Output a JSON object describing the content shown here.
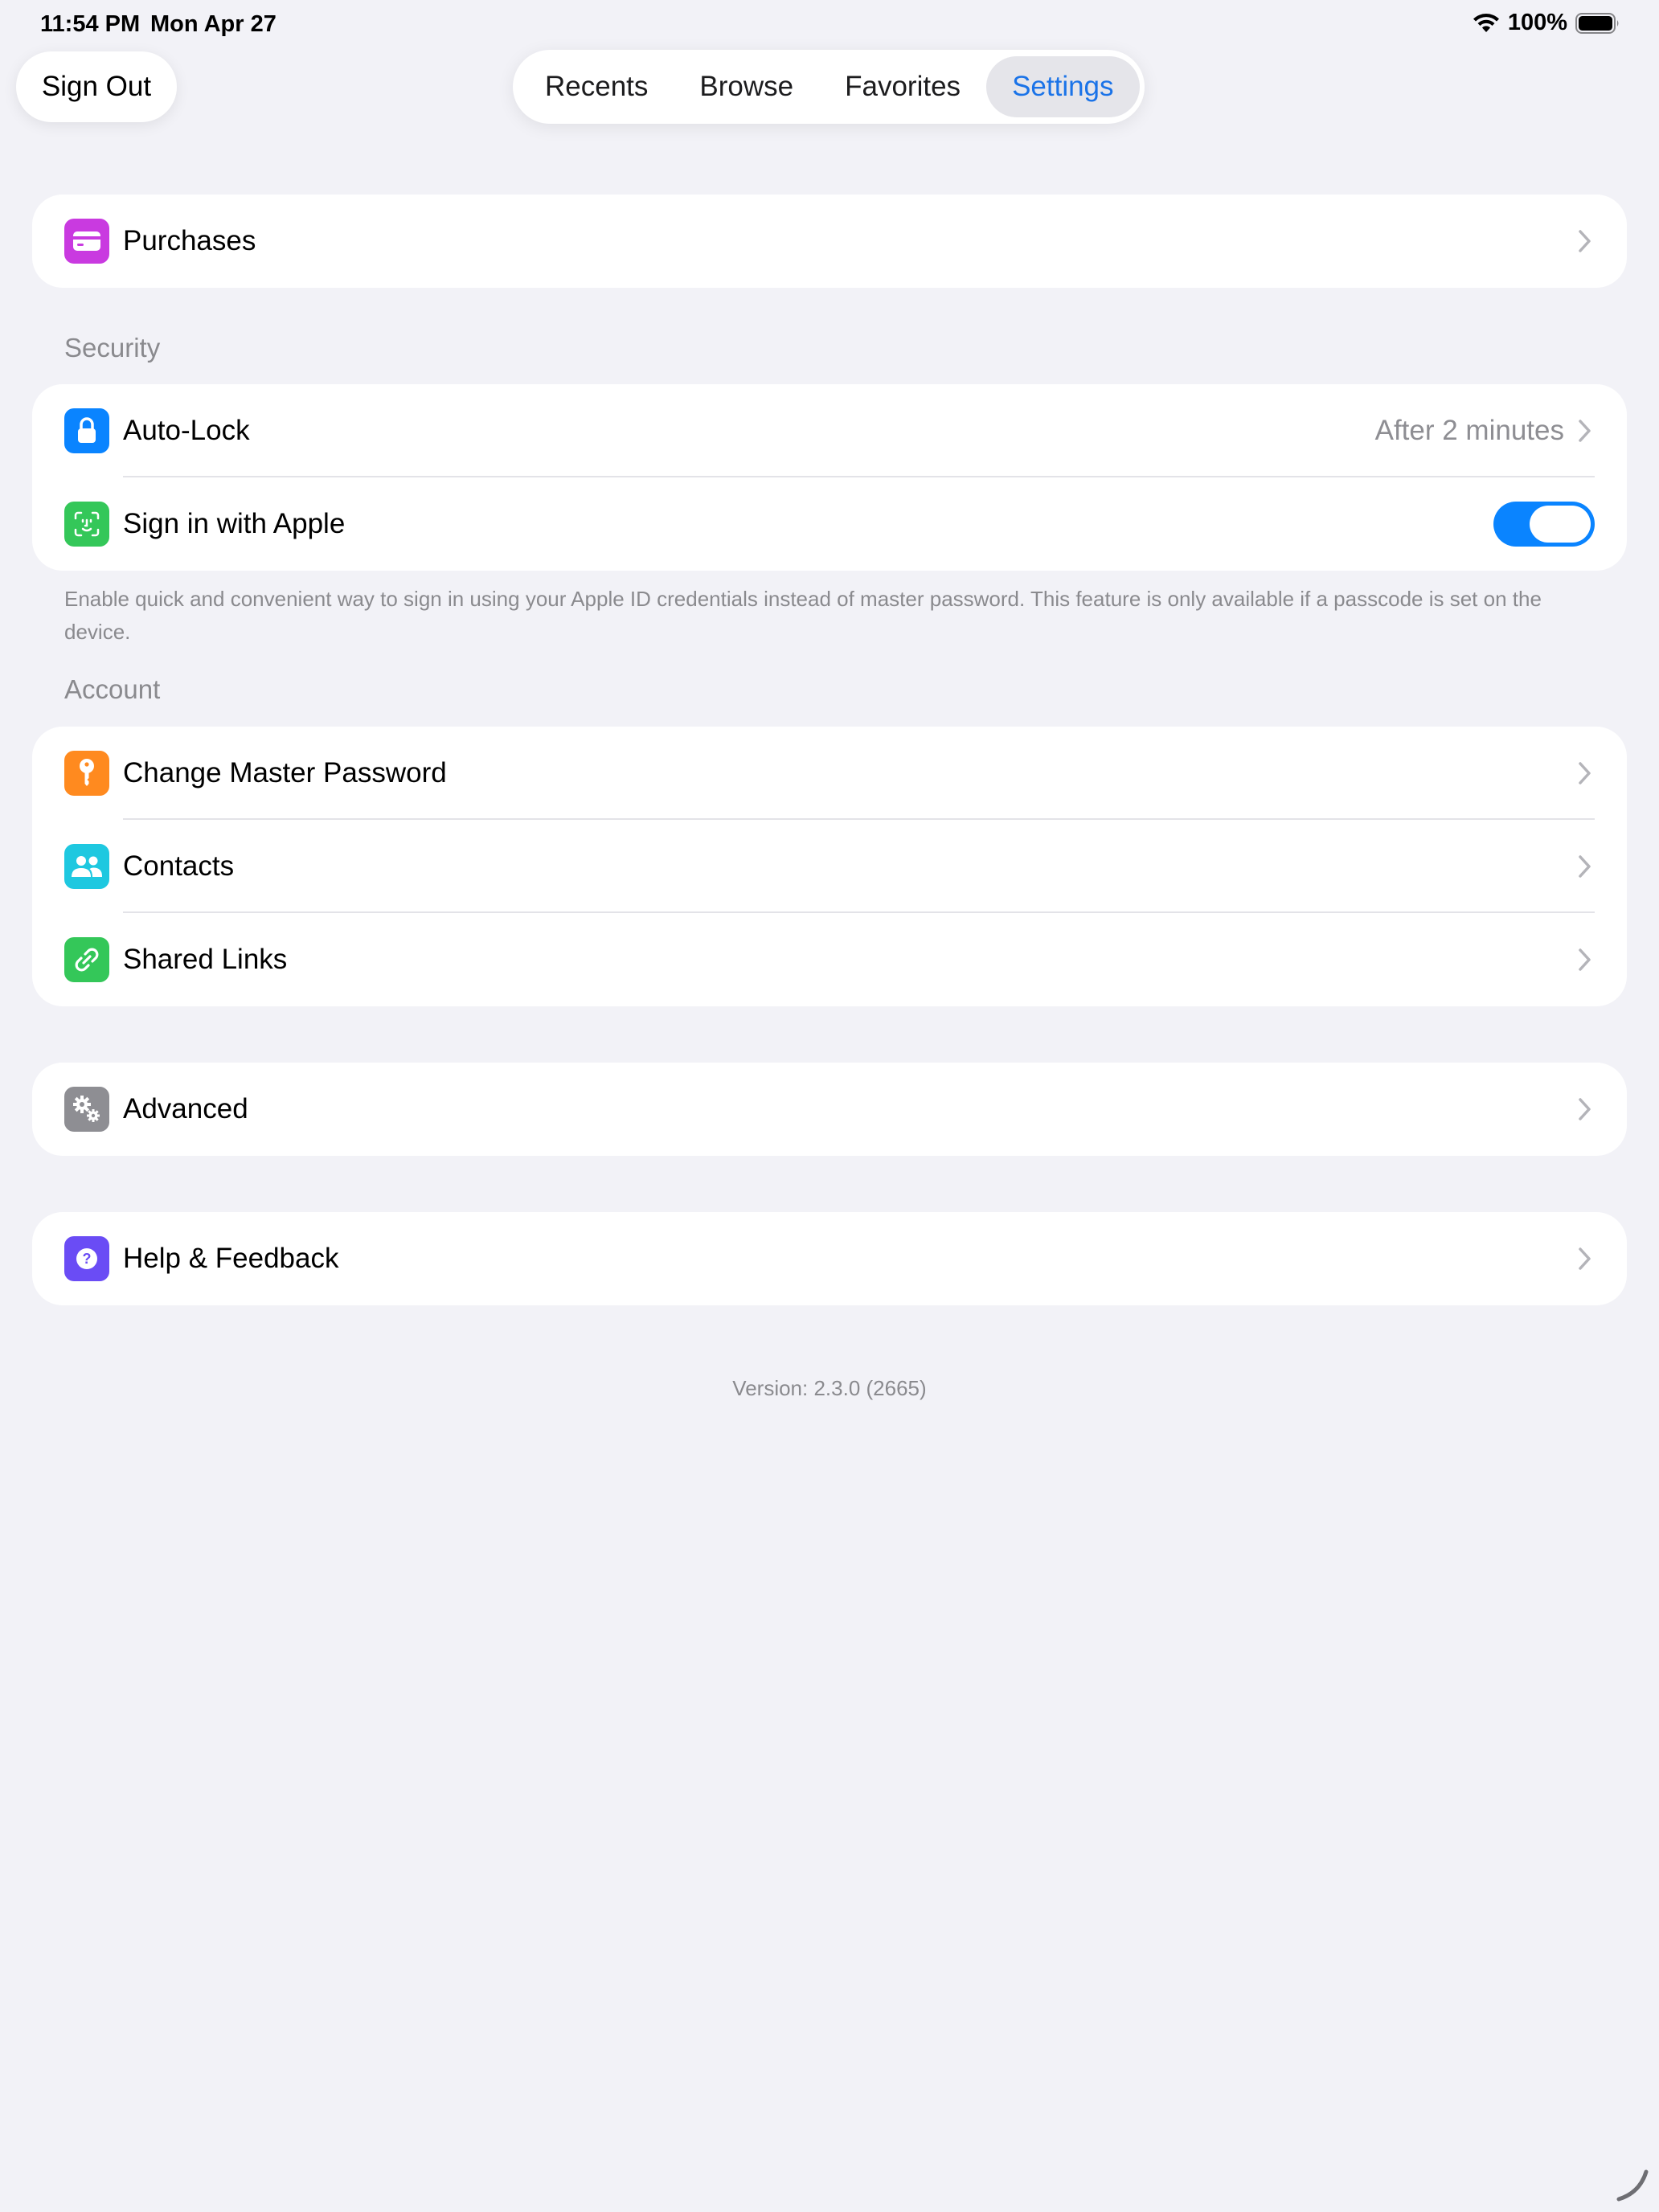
{
  "status_bar": {
    "time": "11:54 PM",
    "date": "Mon Apr 27",
    "battery": "100%"
  },
  "sign_out": {
    "label": "Sign Out"
  },
  "tabs": [
    {
      "label": "Recents"
    },
    {
      "label": "Browse"
    },
    {
      "label": "Favorites"
    },
    {
      "label": "Settings",
      "active": true
    }
  ],
  "purchases": {
    "label": "Purchases",
    "icon": "credit-card-icon",
    "color": "#c93ae0"
  },
  "security": {
    "header": "Security",
    "auto_lock": {
      "label": "Auto-Lock",
      "value": "After 2 minutes",
      "icon": "lock-icon",
      "color": "#0a84ff"
    },
    "sign_in_apple": {
      "label": "Sign in with Apple",
      "icon": "face-id-icon",
      "color": "#34c759",
      "enabled": true
    },
    "footer": "Enable quick and convenient way to sign in using your Apple ID credentials instead of master password. This feature is only available if a passcode is set on the device."
  },
  "account": {
    "header": "Account",
    "items": [
      {
        "label": "Change Master Password",
        "icon": "key-icon",
        "color": "#ff8a1f"
      },
      {
        "label": "Contacts",
        "icon": "people-icon",
        "color": "#1ec8e0"
      },
      {
        "label": "Shared Links",
        "icon": "link-icon",
        "color": "#34c759"
      }
    ]
  },
  "advanced": {
    "label": "Advanced",
    "icon": "gears-icon",
    "color": "#8e8e93"
  },
  "help": {
    "label": "Help & Feedback",
    "icon": "question-icon",
    "color": "#6a4cf5"
  },
  "version": "Version: 2.3.0 (2665)",
  "colors": {
    "accent": "#0a84ff",
    "active_tab_text": "#1a73e8",
    "background": "#f2f2f7"
  }
}
